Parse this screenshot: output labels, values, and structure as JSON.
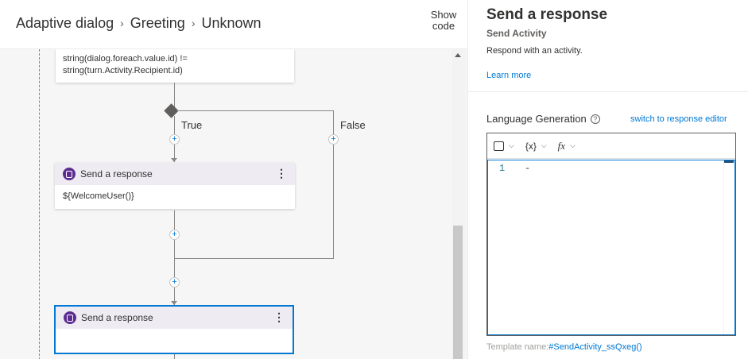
{
  "breadcrumb": {
    "items": [
      "Adaptive dialog",
      "Greeting",
      "Unknown"
    ],
    "separator": "›"
  },
  "header": {
    "show_code_line1": "Show",
    "show_code_line2": "code"
  },
  "canvas": {
    "condition_text_line1": "string(dialog.foreach.value.id) !=",
    "condition_text_line2": "string(turn.Activity.Recipient.id)",
    "branch_true": "True",
    "branch_false": "False",
    "plus_symbol": "+",
    "cards": [
      {
        "title": "Send a response",
        "body": "${WelcomeUser()}",
        "selected": false
      },
      {
        "title": "Send a response",
        "body": "",
        "selected": true
      }
    ],
    "kebab_symbol": "⋮"
  },
  "panel": {
    "title": "Send a response",
    "subtitle": "Send Activity",
    "description": "Respond with an activity.",
    "learn_more": "Learn more",
    "lg_label": "Language Generation",
    "info_symbol": "?",
    "switch_link": "switch to response editor",
    "toolbar": {
      "variables_label": "{x}",
      "functions_label": "fx",
      "chevron": "⌵"
    },
    "editor": {
      "line_number": "1",
      "line_text": "-"
    },
    "template_name_label": "Template name:",
    "template_name_value": "#SendActivity_ssQxeg()"
  },
  "colors": {
    "accent": "#0078d4",
    "bot_icon": "#5c2d91",
    "card_header": "#eeebf3"
  }
}
